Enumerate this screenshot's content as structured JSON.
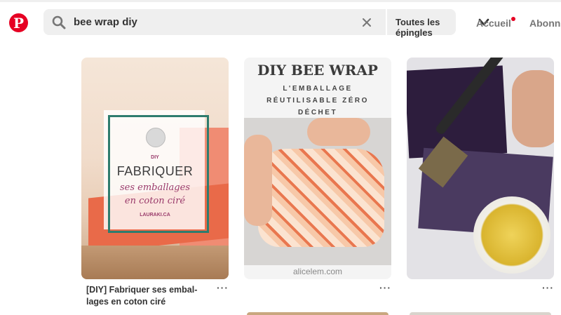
{
  "header": {
    "logo": "P",
    "search": {
      "query": "bee wrap diy"
    },
    "scope_label": "Toutes les épingles",
    "nav": {
      "home": "Accueil",
      "subscriptions": "Abonn"
    }
  },
  "pins": [
    {
      "overlay": {
        "category": "DIY",
        "title": "FABRIQUER",
        "subtitle_line1": "ses emballages",
        "subtitle_line2": "en coton ciré",
        "site": "LAURAKI.CA"
      },
      "caption_line1": "[DIY] Fabriquer ses embal-",
      "caption_line2": "lages en coton ciré",
      "more": "···"
    },
    {
      "overlay": {
        "title": "DIY BEE WRAP",
        "sub_line1": "L'EMBALLAGE",
        "sub_line2": "RÉUTILISABLE ZÉRO",
        "sub_line3": "DÉCHET"
      },
      "source": "alicelem.com",
      "more": "···"
    },
    {
      "more": "···"
    }
  ],
  "colors": {
    "brand": "#e60023",
    "accent_frame": "#2e7c6e"
  }
}
